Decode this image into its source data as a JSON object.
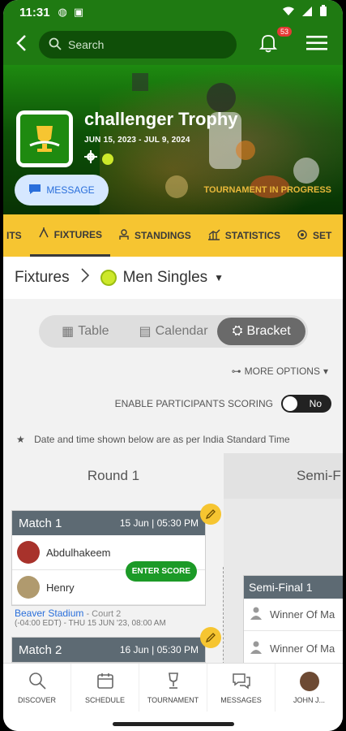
{
  "status_bar": {
    "time": "11:31"
  },
  "app_bar": {
    "search_placeholder": "Search",
    "notification_count": "53"
  },
  "tournament": {
    "title": "challenger Trophy",
    "dates": "JUN 15, 2023 - JUL 9, 2024",
    "message_label": "MESSAGE",
    "status": "TOURNAMENT IN PROGRESS"
  },
  "tabs": [
    {
      "label": "ITS"
    },
    {
      "label": "FIXTURES"
    },
    {
      "label": "STANDINGS"
    },
    {
      "label": "STATISTICS"
    },
    {
      "label": "SET"
    }
  ],
  "breadcrumb": {
    "root": "Fixtures",
    "category": "Men Singles"
  },
  "view_toggle": {
    "table": "Table",
    "calendar": "Calendar",
    "bracket": "Bracket"
  },
  "more_options": "MORE OPTIONS",
  "scoring": {
    "label": "ENABLE PARTICIPANTS SCORING",
    "value": "No"
  },
  "timezone_note": "Date and time shown below are as per India Standard Time",
  "rounds": [
    "Round 1",
    "Semi-F"
  ],
  "matches": [
    {
      "title": "Match 1",
      "datetime": "15 Jun | 05:30 PM",
      "player1": "Abdulhakeem",
      "player2": "Henry",
      "enter_score": "ENTER SCORE",
      "venue": "Beaver Stadium",
      "court": "- Court 2",
      "time_note": "(-04:00 EDT) - THU 15 JUN '23, 08:00 AM"
    },
    {
      "title": "Match 2",
      "datetime": "16 Jun | 05:30 PM"
    }
  ],
  "semi_final": {
    "title": "Semi-Final 1",
    "slot1": "Winner Of Ma",
    "slot2": "Winner Of Ma"
  },
  "bottom_nav": {
    "discover": "DISCOVER",
    "schedule": "SCHEDULE",
    "tournament": "TOURNAMENT",
    "messages": "MESSAGES",
    "profile": "JOHN J..."
  },
  "colors": {
    "primary_green": "#1f7a12",
    "tab_yellow": "#f6c531",
    "match_header": "#5d6a73",
    "score_green": "#1c9a27"
  }
}
